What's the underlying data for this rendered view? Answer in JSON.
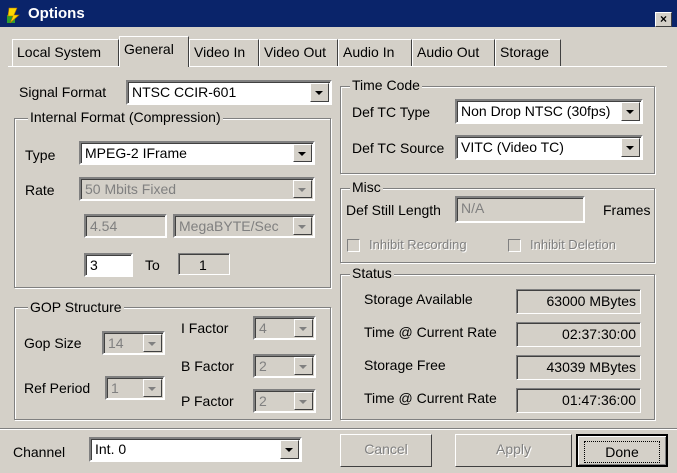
{
  "window": {
    "title": "Options",
    "close_label": "×"
  },
  "tabs": [
    {
      "label": "Local System",
      "active": false
    },
    {
      "label": "General",
      "active": true
    },
    {
      "label": "Video In",
      "active": false
    },
    {
      "label": "Video Out",
      "active": false
    },
    {
      "label": "Audio In",
      "active": false
    },
    {
      "label": "Audio Out",
      "active": false
    },
    {
      "label": "Storage",
      "active": false
    }
  ],
  "signal_format": {
    "label": "Signal Format",
    "value": "NTSC CCIR-601"
  },
  "internal_format": {
    "title": "Internal Format (Compression)",
    "type_label": "Type",
    "type_value": "MPEG-2 IFrame",
    "rate_label": "Rate",
    "rate_value": "50 Mbits Fixed",
    "rate_number": "4.54",
    "rate_unit": "MegaBYTE/Sec",
    "range_from": "3",
    "range_to_label": "To",
    "range_to": "1"
  },
  "gop": {
    "title": "GOP Structure",
    "gop_size_label": "Gop Size",
    "gop_size": "14",
    "ref_period_label": "Ref Period",
    "ref_period": "1",
    "i_factor_label": "I Factor",
    "i_factor": "4",
    "b_factor_label": "B Factor",
    "b_factor": "2",
    "p_factor_label": "P Factor",
    "p_factor": "2"
  },
  "time_code": {
    "title": "Time Code",
    "type_label": "Def TC Type",
    "type_value": "Non Drop NTSC (30fps)",
    "source_label": "Def TC Source",
    "source_value": "VITC (Video TC)"
  },
  "misc": {
    "title": "Misc",
    "still_label": "Def Still Length",
    "still_value": "N/A",
    "still_unit": "Frames",
    "inhibit_recording": "Inhibit Recording",
    "inhibit_deletion": "Inhibit Deletion"
  },
  "status": {
    "title": "Status",
    "storage_available_label": "Storage Available",
    "storage_available": "63000 MBytes",
    "time_current_label_1": "Time @ Current Rate",
    "time_current_1": "02:37:30:00",
    "storage_free_label": "Storage Free",
    "storage_free": "43039 MBytes",
    "time_current_label_2": "Time @ Current Rate",
    "time_current_2": "01:47:36:00"
  },
  "channel": {
    "label": "Channel",
    "value": "Int. 0"
  },
  "buttons": {
    "cancel": "Cancel",
    "apply": "Apply",
    "done": "Done"
  }
}
